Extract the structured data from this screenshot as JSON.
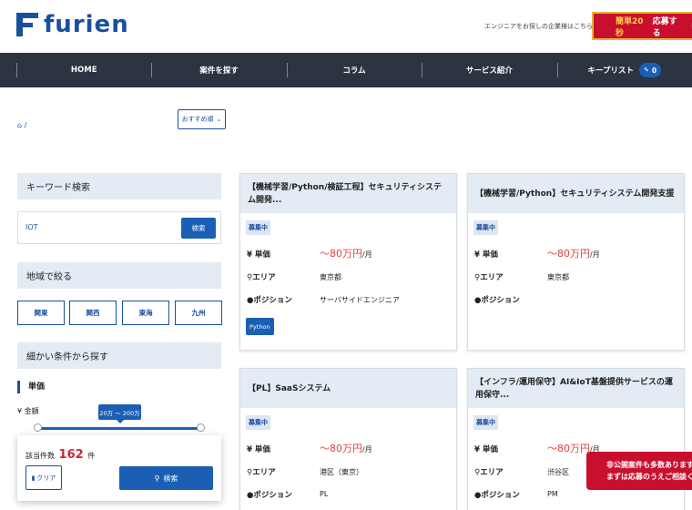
{
  "header": {
    "logo_text": "furien",
    "corp_link": "エンジニアをお探しの企業様はこちら",
    "apply_highlight": "簡単20秒",
    "apply_label": "応募する",
    "apply_arrow": "›"
  },
  "nav": {
    "items": [
      "HOME",
      "案件を探す",
      "コラム",
      "サービス紹介",
      "キープリスト"
    ],
    "keep_count": "0"
  },
  "breadcrumb": {
    "home_icon": "⌂",
    "separator": "/"
  },
  "sort": {
    "selected": "おすすめ順",
    "chevron": "⌄"
  },
  "sidebar": {
    "keyword_title": "キーワード検索",
    "keyword_value": "IOT",
    "keyword_button": "検索",
    "region_title": "地域で絞る",
    "regions": [
      "関東",
      "関西",
      "東海",
      "九州"
    ],
    "detail_title": "細かい条件から探す",
    "price_title": "単価",
    "price_label": "¥ 金額",
    "price_range": "20万 〜 200万",
    "count_prefix": "該当件数",
    "count": "162",
    "count_suffix": "件",
    "clear_label": "クリア",
    "search_label": "検索"
  },
  "labels": {
    "status": "募集中",
    "unit_price": "単価",
    "area": "エリア",
    "position": "ポジション",
    "per_month": "/月"
  },
  "jobs": [
    {
      "title": "【機械学習/Python/検証工程】セキュリティシステム開発...",
      "price": "〜80万円",
      "area": "東京都",
      "position": "サーバサイドエンジニア",
      "tag": "Python"
    },
    {
      "title": "【機械学習/Python】セキュリティシステム開発支援",
      "price": "〜80万円",
      "area": "東京都",
      "position": ""
    },
    {
      "title": "【PL】SaaSシステム",
      "price": "〜80万円",
      "area": "港区（東京）",
      "position": "PL"
    },
    {
      "title": "【インフラ/運用保守】AI&IoT基盤提供サービスの運用保守...",
      "price": "〜80万円",
      "area": "渋谷区",
      "position": "PM"
    }
  ],
  "secret_tab": {
    "line1": "非公開案件も多数あります",
    "line2": "まずは応募のうえご相談くだ"
  }
}
